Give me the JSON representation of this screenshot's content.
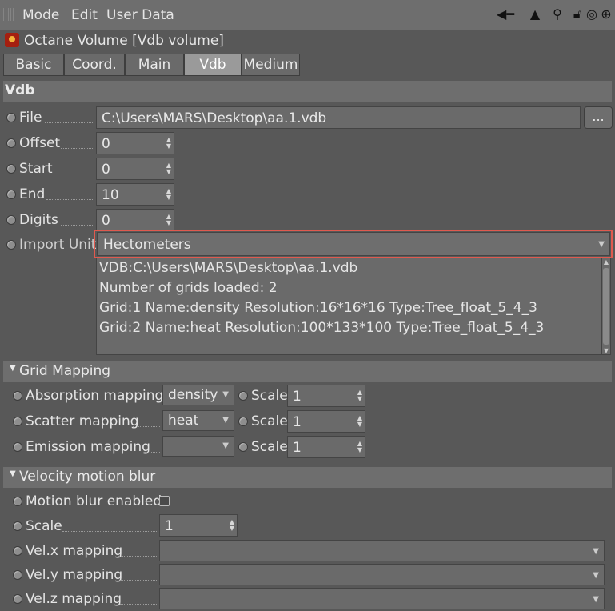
{
  "menubar": {
    "items": [
      "Mode",
      "Edit",
      "User Data"
    ]
  },
  "object": {
    "title": "Octane Volume [Vdb volume]"
  },
  "tabs": [
    {
      "label": "Basic",
      "active": false
    },
    {
      "label": "Coord.",
      "active": false
    },
    {
      "label": "Main",
      "active": false
    },
    {
      "label": "Vdb",
      "active": true
    },
    {
      "label": "Medium",
      "active": false
    }
  ],
  "vdb": {
    "section_title": "Vdb",
    "file": {
      "label": "File",
      "value": "C:\\Users\\MARS\\Desktop\\aa.1.vdb",
      "browse": "..."
    },
    "offset": {
      "label": "Offset",
      "value": "0"
    },
    "start": {
      "label": "Start",
      "value": "0"
    },
    "end": {
      "label": "End",
      "value": "10"
    },
    "digits": {
      "label": "Digits",
      "value": "0"
    },
    "import_unit": {
      "label": "Import Unit",
      "value": "Hectometers"
    },
    "info_lines": [
      "VDB:C:\\Users\\MARS\\Desktop\\aa.1.vdb",
      "Number of grids loaded: 2",
      "Grid:1  Name:density  Resolution:16*16*16  Type:Tree_float_5_4_3",
      "Grid:2  Name:heat  Resolution:100*133*100  Type:Tree_float_5_4_3"
    ]
  },
  "grid_mapping": {
    "title": "Grid Mapping",
    "rows": [
      {
        "label": "Absorption mapping",
        "value": "density",
        "scale_label": "Scale",
        "scale": "1"
      },
      {
        "label": "Scatter mapping",
        "value": "heat",
        "scale_label": "Scale",
        "scale": "1"
      },
      {
        "label": "Emission mapping",
        "value": "",
        "scale_label": "Scale",
        "scale": "1"
      }
    ]
  },
  "velocity": {
    "title": "Velocity motion blur",
    "motion_blur_label": "Motion blur enabled",
    "scale_label": "Scale",
    "scale_value": "1",
    "velx_label": "Vel.x mapping",
    "vely_label": "Vel.y mapping",
    "velz_label": "Vel.z mapping"
  },
  "icons": [
    "grip-icon",
    "back-arrow-icon",
    "cursor-arrow-icon",
    "search-icon",
    "lock-icon",
    "target-icon",
    "add-icon"
  ]
}
